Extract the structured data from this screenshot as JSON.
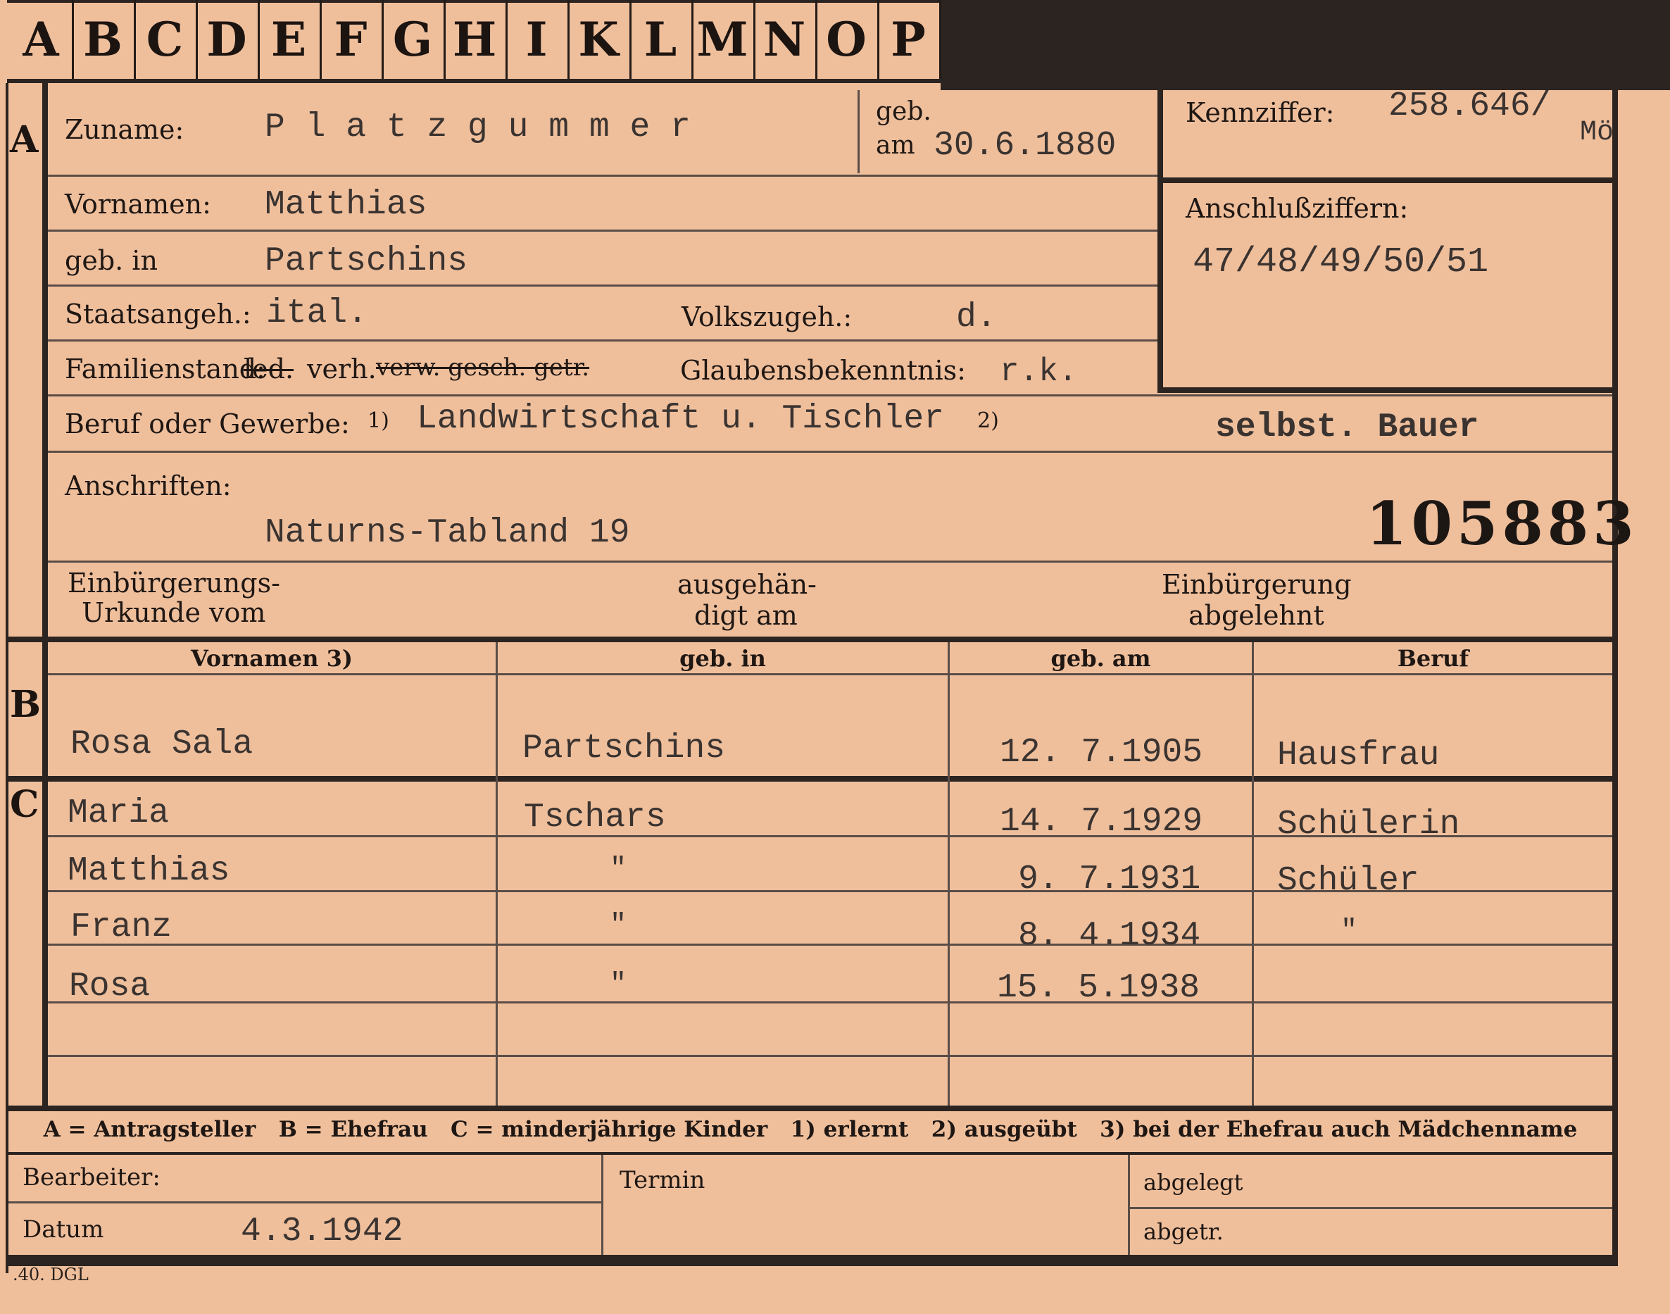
{
  "tabs": [
    "A",
    "B",
    "C",
    "D",
    "E",
    "F",
    "G",
    "H",
    "I",
    "K",
    "L",
    "M",
    "N",
    "O",
    "P"
  ],
  "sections": {
    "a": "A",
    "b": "B",
    "c": "C"
  },
  "header": {
    "zuname_label": "Zuname:",
    "zuname_value": "P l a t z g u m m e r",
    "geb_label": "geb.",
    "am_label": "am",
    "geb_am_value": "30.6.1880",
    "kennziffer_label": "Kennziffer:",
    "kennziffer_value": "258.646/",
    "kennziffer_suffix": "Mö",
    "anschluss_label": "Anschlußziffern:",
    "anschluss_value": "47/48/49/50/51"
  },
  "person": {
    "vornamen_label": "Vornamen:",
    "vornamen_value": "Matthias",
    "gebin_label": "geb. in",
    "gebin_value": "Partschins",
    "staat_label": "Staatsangeh.:",
    "staat_value": "ital.",
    "volk_label": "Volkszugeh.:",
    "volk_value": "d.",
    "familien_label": "Familienstand:",
    "familien_struck1": "led.",
    "familien_value": "verh.",
    "familien_struck2": "verw. gesch. getr.",
    "glauben_label": "Glaubensbekenntnis:",
    "glauben_value": "r.k.",
    "beruf_label": "Beruf oder Gewerbe:",
    "beruf_mark1": "1)",
    "beruf_value1": "Landwirtschaft u. Tischler",
    "beruf_mark2": "2)",
    "beruf_value2": "selbst. Bauer",
    "anschriften_label": "Anschriften:",
    "anschriften_value": "Naturns-Tabland 19",
    "number": "105883",
    "einb_label1": "Einbürgerungs-",
    "einb_label2": "Urkunde vom",
    "ausg_label1": "ausgehän-",
    "ausg_label2": "digt am",
    "abgel_label1": "Einbürgerung",
    "abgel_label2": "abgelehnt"
  },
  "table_headers": {
    "vornamen": "Vornamen 3)",
    "gebin": "geb. in",
    "gebam": "geb. am",
    "beruf": "Beruf"
  },
  "spouse": {
    "vornamen": "Rosa Sala",
    "gebin": "Partschins",
    "gebam": "12. 7.1905",
    "beruf": "Hausfrau"
  },
  "children": [
    {
      "vornamen": "Maria",
      "gebin": "Tschars",
      "gebam": "14. 7.1929",
      "beruf": "Schülerin"
    },
    {
      "vornamen": "Matthias",
      "gebin": "\"",
      "gebam": "9. 7.1931",
      "beruf": "Schüler"
    },
    {
      "vornamen": "Franz",
      "gebin": "\"",
      "gebam": "8. 4.1934",
      "beruf": "\""
    },
    {
      "vornamen": "Rosa",
      "gebin": "\"",
      "gebam": "15. 5.1938",
      "beruf": ""
    }
  ],
  "legend": "A = Antragsteller   B = Ehefrau   C = minderjährige Kinder   1) erlernt   2) ausgeübt   3) bei der Ehefrau auch Mädchenname",
  "footer": {
    "bearbeiter_label": "Bearbeiter:",
    "datum_label": "Datum",
    "datum_value": "4.3.1942",
    "termin_label": "Termin",
    "abgelegt_label": "abgelegt",
    "abgetr_label": "abgetr.",
    "print_mark": ".40. DGL"
  }
}
